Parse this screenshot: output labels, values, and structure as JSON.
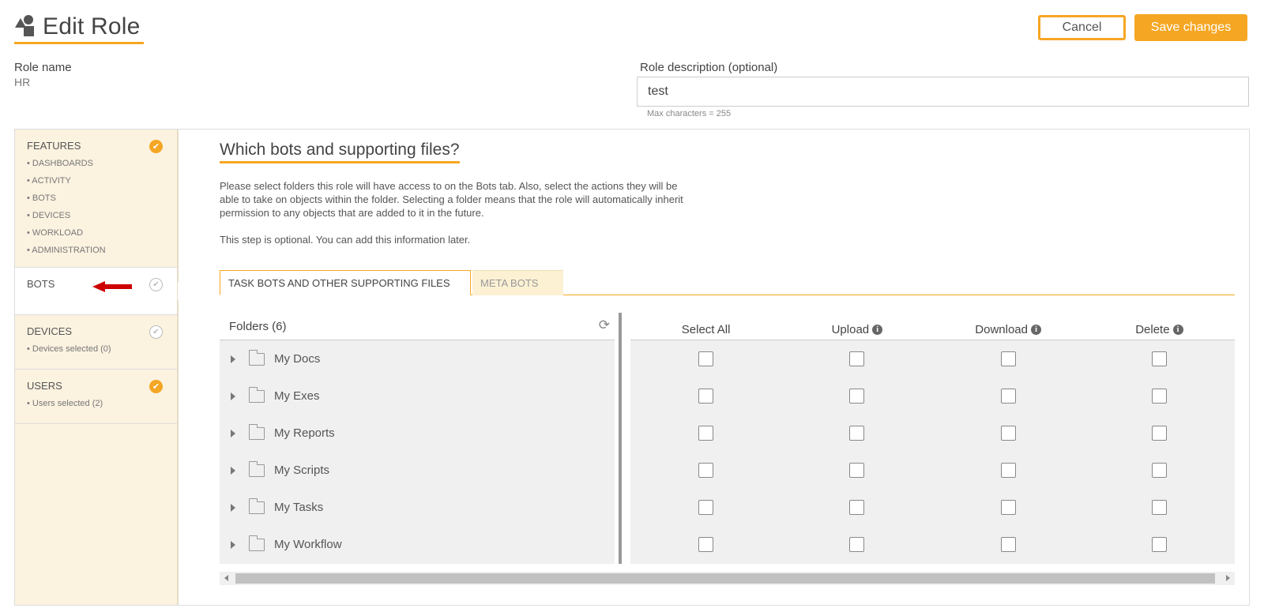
{
  "header": {
    "title": "Edit Role",
    "icon": "shapes-icon",
    "cancel_label": "Cancel",
    "save_label": "Save changes"
  },
  "role": {
    "name_label": "Role name",
    "name_value": "HR",
    "description_label": "Role description (optional)",
    "description_value": "test",
    "description_hint": "Max characters = 255"
  },
  "sidebar": {
    "sections": [
      {
        "title": "FEATURES",
        "status": "complete",
        "items": [
          "• DASHBOARDS",
          "• ACTIVITY",
          "• BOTS",
          "• DEVICES",
          "• WORKLOAD",
          "• ADMINISTRATION"
        ]
      },
      {
        "title": "BOTS",
        "status": "pending",
        "active": true,
        "items": []
      },
      {
        "title": "DEVICES",
        "status": "pending",
        "items": [
          "• Devices selected (0)"
        ]
      },
      {
        "title": "USERS",
        "status": "complete",
        "items": [
          "• Users selected (2)"
        ]
      }
    ]
  },
  "main": {
    "heading": "Which bots and supporting files?",
    "description": "Please select folders this role will have access to on the Bots tab. Also, select the actions they will be able to take on objects within the folder. Selecting a folder means that the role will automatically inherit permission to any objects that are added to it in the future.",
    "optional_note": "This step is optional. You can add this information later.",
    "tabs": [
      {
        "label": "TASK BOTS AND OTHER SUPPORTING FILES",
        "active": true
      },
      {
        "label": "META BOTS",
        "active": false
      }
    ],
    "folders_header": "Folders (6)",
    "folders": [
      "My Docs",
      "My Exes",
      "My Reports",
      "My Scripts",
      "My Tasks",
      "My Workflow"
    ],
    "permission_columns": [
      "Select All",
      "Upload",
      "Download",
      "Delete"
    ]
  },
  "colors": {
    "accent": "#f5a623",
    "sidebar_bg": "#fbf2e0",
    "annotation_arrow": "#cc0000"
  }
}
